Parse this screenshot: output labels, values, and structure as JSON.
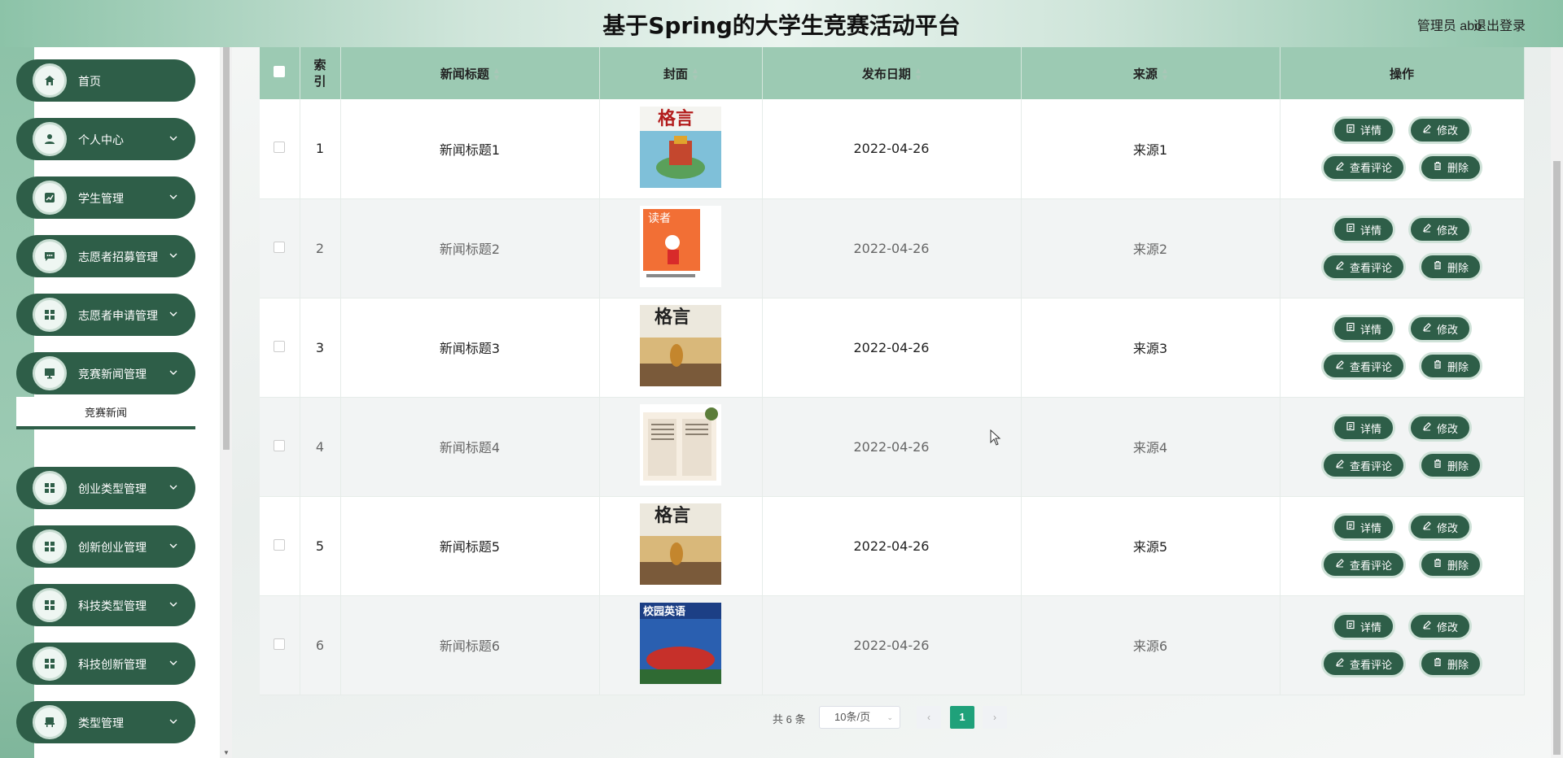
{
  "header": {
    "title": "基于Spring的大学生竞赛活动平台",
    "user_label": "管理员 abo",
    "logout_label": "退出登录"
  },
  "sidebar": {
    "items": [
      {
        "label": "首页",
        "icon": "home-icon",
        "has_children": false
      },
      {
        "label": "个人中心",
        "icon": "user-icon",
        "has_children": true
      },
      {
        "label": "学生管理",
        "icon": "chart-icon",
        "has_children": true
      },
      {
        "label": "志愿者招募管理",
        "icon": "chat-icon",
        "has_children": true
      },
      {
        "label": "志愿者申请管理",
        "icon": "grid-icon",
        "has_children": true
      },
      {
        "label": "竞赛新闻管理",
        "icon": "monitor-icon",
        "has_children": true
      },
      {
        "label": "创业类型管理",
        "icon": "grid-icon",
        "has_children": true
      },
      {
        "label": "创新创业管理",
        "icon": "grid-icon",
        "has_children": true
      },
      {
        "label": "科技类型管理",
        "icon": "grid-icon",
        "has_children": true
      },
      {
        "label": "科技创新管理",
        "icon": "grid-icon",
        "has_children": true
      },
      {
        "label": "类型管理",
        "icon": "chair-icon",
        "has_children": true
      }
    ],
    "sub_item_label": "竞赛新闻"
  },
  "table": {
    "columns": {
      "index": "索引",
      "title": "新闻标题",
      "cover": "封面",
      "date": "发布日期",
      "source": "来源",
      "actions": "操作"
    },
    "rows": [
      {
        "index": "1",
        "title": "新闻标题1",
        "date": "2022-04-26",
        "source": "来源1"
      },
      {
        "index": "2",
        "title": "新闻标题2",
        "date": "2022-04-26",
        "source": "来源2"
      },
      {
        "index": "3",
        "title": "新闻标题3",
        "date": "2022-04-26",
        "source": "来源3"
      },
      {
        "index": "4",
        "title": "新闻标题4",
        "date": "2022-04-26",
        "source": "来源4"
      },
      {
        "index": "5",
        "title": "新闻标题5",
        "date": "2022-04-26",
        "source": "来源5"
      },
      {
        "index": "6",
        "title": "新闻标题6",
        "date": "2022-04-26",
        "source": "来源6"
      }
    ],
    "action_labels": {
      "detail": "详情",
      "edit": "修改",
      "comments": "查看评论",
      "delete": "删除"
    }
  },
  "pagination": {
    "total": "共 6 条",
    "page_size": "10条/页",
    "current_page": "1"
  },
  "colors": {
    "primary": "#2e5e48",
    "header_bg": "#9ccab3",
    "active_page": "#1fa17a"
  }
}
